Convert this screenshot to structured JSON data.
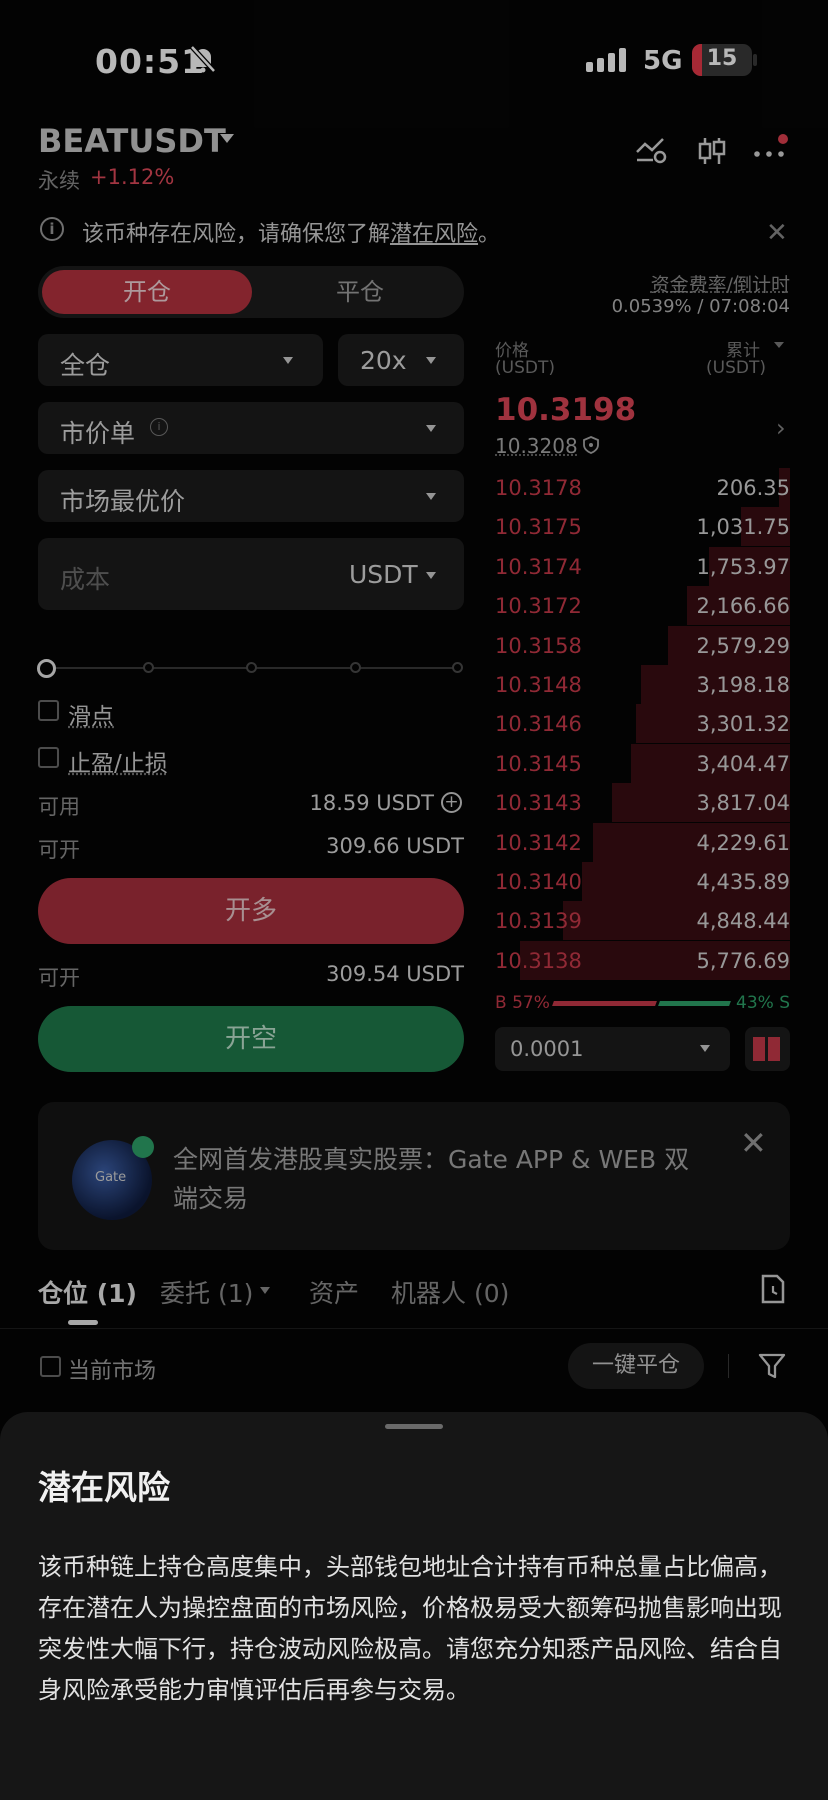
{
  "status_bar": {
    "time": "00:51",
    "network": "5G",
    "battery": "15"
  },
  "header": {
    "pair": "BEATUSDT",
    "contract_type": "永续",
    "change": "+1.12%"
  },
  "notice": {
    "text_prefix": "该币种存在风险，请确保您了解",
    "link": "潜在风险",
    "text_suffix": "。"
  },
  "order_form": {
    "tab_open": "开仓",
    "tab_close": "平仓",
    "margin_mode": "全仓",
    "leverage": "20x",
    "order_type": "市价单",
    "price_type": "市场最优价",
    "cost_placeholder": "成本",
    "cost_unit": "USDT",
    "slippage_label": "滑点",
    "tpsl_label": "止盈/止损",
    "available_label": "可用",
    "available_value": "18.59 USDT",
    "can_open_label": "可开",
    "can_open_long": "309.66 USDT",
    "long_button": "开多",
    "can_open_short": "309.54 USDT",
    "short_button": "开空"
  },
  "order_book": {
    "funding_label": "资金费率/倒计时",
    "funding_value": "0.0539% / 07:08:04",
    "price_header": "价格",
    "price_unit": "(USDT)",
    "total_header": "累计",
    "total_unit": "(USDT)",
    "last_price": "10.3198",
    "mark_price": "10.3208",
    "asks": [
      {
        "price": "10.3178",
        "total": "206.35",
        "depth": 0.04
      },
      {
        "price": "10.3175",
        "total": "1,031.75",
        "depth": 0.18
      },
      {
        "price": "10.3174",
        "total": "1,753.97",
        "depth": 0.3
      },
      {
        "price": "10.3172",
        "total": "2,166.66",
        "depth": 0.38
      },
      {
        "price": "10.3158",
        "total": "2,579.29",
        "depth": 0.45
      },
      {
        "price": "10.3148",
        "total": "3,198.18",
        "depth": 0.55
      },
      {
        "price": "10.3146",
        "total": "3,301.32",
        "depth": 0.57
      },
      {
        "price": "10.3145",
        "total": "3,404.47",
        "depth": 0.59
      },
      {
        "price": "10.3143",
        "total": "3,817.04",
        "depth": 0.66
      },
      {
        "price": "10.3142",
        "total": "4,229.61",
        "depth": 0.73
      },
      {
        "price": "10.3140",
        "total": "4,435.89",
        "depth": 0.77
      },
      {
        "price": "10.3139",
        "total": "4,848.44",
        "depth": 0.84
      },
      {
        "price": "10.3138",
        "total": "5,776.69",
        "depth": 1.0
      }
    ],
    "buy_ratio": "B 57%",
    "sell_ratio": "43% S",
    "precision": "0.0001"
  },
  "banner": {
    "logo_text": "Gate",
    "text": "全网首发港股真实股票：Gate APP & WEB 双端交易"
  },
  "tabs": {
    "positions": "仓位 (1)",
    "orders": "委托 (1)",
    "assets": "资产",
    "bots": "机器人 (0)"
  },
  "positions_toolbar": {
    "current_market": "当前市场",
    "close_all": "一键平仓"
  },
  "sheet": {
    "title": "潜在风险",
    "body": "该币种链上持仓高度集中，头部钱包地址合计持有币种总量占比偏高，存在潜在人为操控盘面的市场风险，价格极易受大额筹码抛售影响出现突发性大幅下行，持仓波动风险极高。请您充分知悉产品风险、结合自身风险承受能力审慎评估后再参与交易。"
  },
  "colors": {
    "red": "#c83a4a",
    "green": "#2ea36a",
    "background": "#050505"
  }
}
